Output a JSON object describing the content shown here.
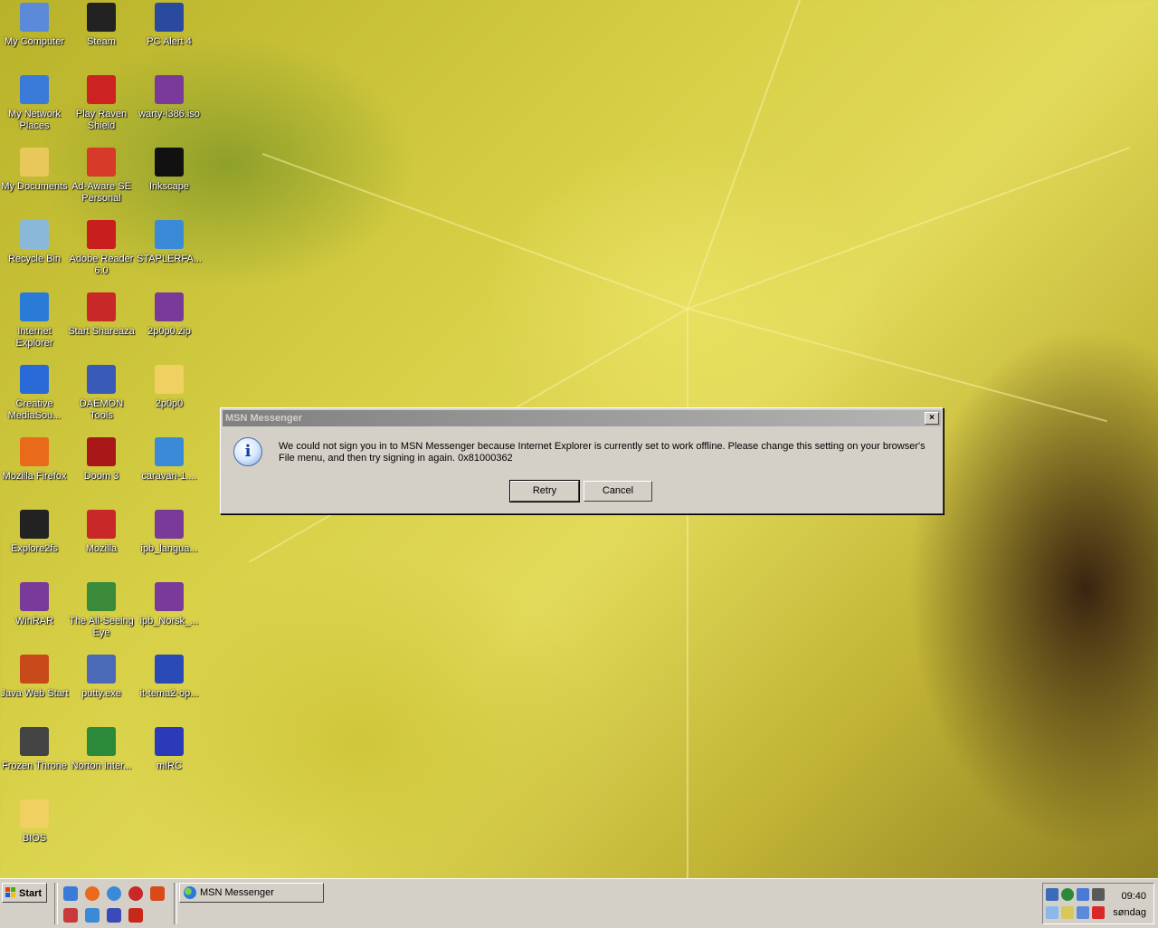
{
  "desktop": {
    "icons": [
      {
        "label": "My Computer",
        "glyph": "computer-icon",
        "color": "#5a8ad8"
      },
      {
        "label": "Steam",
        "glyph": "steam-icon",
        "color": "#222222"
      },
      {
        "label": "PC Alert 4",
        "glyph": "pc-alert-icon",
        "color": "#2a4aa0"
      },
      {
        "label": "My Network Places",
        "glyph": "network-icon",
        "color": "#3a7ad8"
      },
      {
        "label": "Play Raven Shield",
        "glyph": "raven-shield-icon",
        "color": "#cc2222"
      },
      {
        "label": "warty-i386.iso",
        "glyph": "winrar-archive-icon",
        "color": "#7a3a9a"
      },
      {
        "label": "My Documents",
        "glyph": "documents-folder-icon",
        "color": "#e8c85a"
      },
      {
        "label": "Ad-Aware SE Personal",
        "glyph": "ad-aware-icon",
        "color": "#d83a2a"
      },
      {
        "label": "Inkscape",
        "glyph": "inkscape-icon",
        "color": "#111111"
      },
      {
        "label": "Recycle Bin",
        "glyph": "recycle-bin-icon",
        "color": "#8ab8d8"
      },
      {
        "label": "Adobe Reader 6.0",
        "glyph": "adobe-reader-icon",
        "color": "#c81e1e"
      },
      {
        "label": "STAPLERFA...",
        "glyph": "media-file-icon",
        "color": "#3a8ad8"
      },
      {
        "label": "Internet Explorer",
        "glyph": "internet-explorer-icon",
        "color": "#2a7ad8"
      },
      {
        "label": "Start Shareaza",
        "glyph": "shareaza-icon",
        "color": "#c82828"
      },
      {
        "label": "2p0p0.zip",
        "glyph": "winrar-archive-icon",
        "color": "#7a3a9a"
      },
      {
        "label": "Creative MediaSou...",
        "glyph": "creative-mediasource-icon",
        "color": "#2a6ad8"
      },
      {
        "label": "DAEMON Tools",
        "glyph": "daemon-tools-icon",
        "color": "#3a5ab8"
      },
      {
        "label": "2p0p0",
        "glyph": "folder-icon",
        "color": "#f0d060"
      },
      {
        "label": "Mozilla Firefox",
        "glyph": "firefox-icon",
        "color": "#e86a1a"
      },
      {
        "label": "Doom 3",
        "glyph": "doom3-icon",
        "color": "#a81818"
      },
      {
        "label": "caravan-1....",
        "glyph": "media-file-icon",
        "color": "#3a8ad8"
      },
      {
        "label": "Explore2fs",
        "glyph": "tux-penguin-icon",
        "color": "#222222"
      },
      {
        "label": "Mozilla",
        "glyph": "mozilla-icon",
        "color": "#c82828"
      },
      {
        "label": "ipb_langua...",
        "glyph": "winrar-archive-icon",
        "color": "#7a3a9a"
      },
      {
        "label": "WinRAR",
        "glyph": "winrar-icon",
        "color": "#7a3a9a"
      },
      {
        "label": "The All-Seeing Eye",
        "glyph": "all-seeing-eye-icon",
        "color": "#3a8a3a"
      },
      {
        "label": "ipb_Norsk_...",
        "glyph": "winrar-archive-icon",
        "color": "#7a3a9a"
      },
      {
        "label": "Java Web Start",
        "glyph": "java-icon",
        "color": "#c84a1a"
      },
      {
        "label": "putty.exe",
        "glyph": "putty-icon",
        "color": "#4a6ab8"
      },
      {
        "label": "it-tema2-op...",
        "glyph": "word-document-icon",
        "color": "#2a4ab8"
      },
      {
        "label": "Frozen Throne",
        "glyph": "frozen-throne-icon",
        "color": "#444444"
      },
      {
        "label": "Norton Inter...",
        "glyph": "norton-icon",
        "color": "#2a8a3a"
      },
      {
        "label": "mIRC",
        "glyph": "mirc-icon",
        "color": "#2a3ab8"
      },
      {
        "label": "BIOS",
        "glyph": "folder-icon",
        "color": "#f0d060"
      }
    ]
  },
  "dialog": {
    "title": "MSN Messenger",
    "close_glyph": "×",
    "info_glyph": "i",
    "message": "We could not sign you in to MSN Messenger because Internet Explorer is currently set to work offline. Please change this setting on your browser's File menu, and then try signing in again.  0x81000362",
    "retry_label": "Retry",
    "cancel_label": "Cancel"
  },
  "taskbar": {
    "start_label": "Start",
    "task_label": "MSN Messenger",
    "clock_time": "09:40",
    "clock_day": "søndag"
  },
  "colors": {
    "dialog_bg": "#d4d0c8",
    "title_gradient_start": "#808080",
    "title_gradient_end": "#b5b5b5"
  }
}
